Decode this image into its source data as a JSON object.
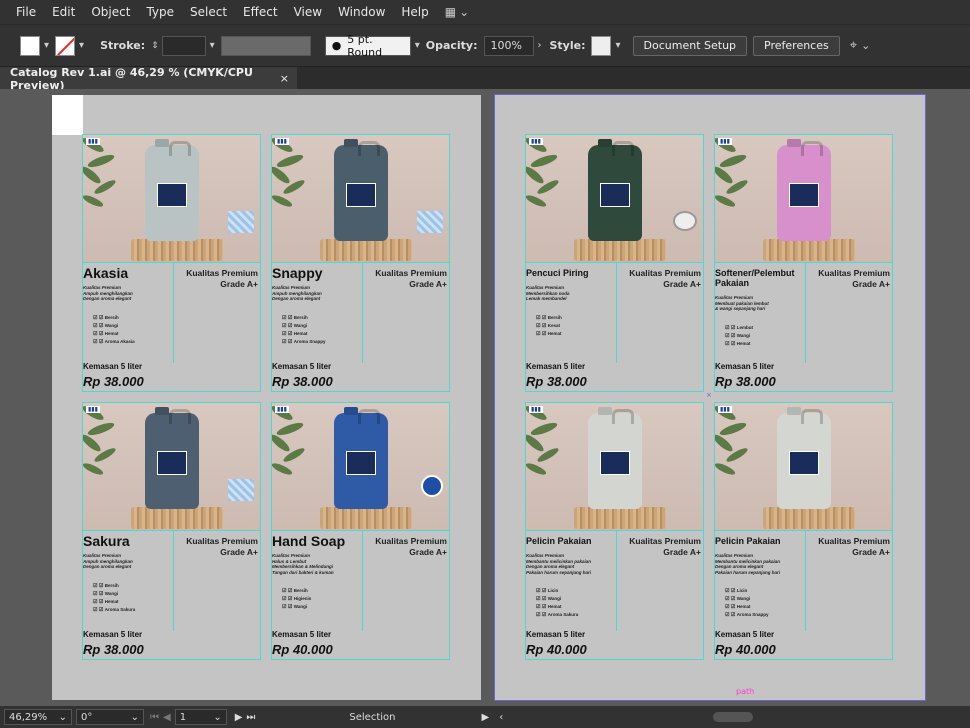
{
  "menu": [
    "File",
    "Edit",
    "Object",
    "Type",
    "Select",
    "Effect",
    "View",
    "Window",
    "Help"
  ],
  "control": {
    "stroke_label": "Stroke:",
    "brush": "5 pt. Round",
    "opacity_label": "Opacity:",
    "opacity": "100%",
    "style_label": "Style:",
    "doc_setup": "Document Setup",
    "preferences": "Preferences"
  },
  "tab": {
    "title": "Catalog Rev 1.ai @ 46,29 % (CMYK/CPU Preview)",
    "close": "×"
  },
  "products": [
    {
      "name": "Akasia",
      "quality": [
        "Kualitas Premium",
        "Grade A+"
      ],
      "desc": [
        "Kualitas Premium",
        "Ampuh menghilangkan",
        "Dengan aroma elegant"
      ],
      "features": [
        "Bersih",
        "Wangi",
        "Hemat",
        "Aroma Akasia"
      ],
      "pack": "Kemasan 5 liter",
      "price": "Rp 38.000",
      "jug": "#b9c3c4",
      "extra": "pattern"
    },
    {
      "name": "Snappy",
      "quality": [
        "Kualitas Premium",
        "Grade A+"
      ],
      "desc": [
        "Kualitas Premium",
        "Ampuh menghilangkan",
        "Dengan aroma elegant"
      ],
      "features": [
        "Bersih",
        "Wangi",
        "Hemat",
        "Aroma Snappy"
      ],
      "pack": "Kemasan 5 liter",
      "price": "Rp 38.000",
      "jug": "#4b5e6c",
      "extra": "pattern"
    },
    {
      "name": "Pencuci Piring",
      "quality": [
        "Kualitas Premium",
        "Grade A+"
      ],
      "desc": [
        "Kualitas Premium",
        "Membersihkan noda",
        "Lemak membandel"
      ],
      "features": [
        "Bersih",
        "Kesat",
        "Hemat"
      ],
      "pack": "Kemasan 5 liter",
      "price": "Rp 38.000",
      "jug": "#2f4a3c",
      "extra": "plate"
    },
    {
      "name": "Softener/Pelembut Pakaian",
      "quality": [
        "Kualitas Premium",
        "Grade A+"
      ],
      "desc": [
        "Kualitas Premium",
        "Membuat pakaian lembut",
        "& wangi sepanjang hari"
      ],
      "features": [
        "Lembut",
        "Wangi",
        "Hemat"
      ],
      "pack": "Kemasan 5 liter",
      "price": "Rp 38.000",
      "jug": "#d790cc",
      "extra": ""
    },
    {
      "name": "Sakura",
      "quality": [
        "Kualitas Premium",
        "Grade A+"
      ],
      "desc": [
        "Kualitas Premium",
        "Ampuh menghilangkan",
        "Dengan aroma elegant"
      ],
      "features": [
        "Bersih",
        "Wangi",
        "Hemat",
        "Aroma Sakura"
      ],
      "pack": "Kemasan 5 liter",
      "price": "Rp 38.000",
      "jug": "#4d5f70",
      "extra": "pattern"
    },
    {
      "name": "Hand Soap",
      "quality": [
        "Kualitas Premium",
        "Grade A+"
      ],
      "desc": [
        "Kualitas Premium",
        "Halus & Lembut",
        "Membersihkan & Melindungi",
        "Tangan dari bakteri & kuman"
      ],
      "features": [
        "Bersih",
        "Higienis",
        "Wangi"
      ],
      "pack": "Kemasan 5 liter",
      "price": "Rp 40.000",
      "jug": "#2e5aa6",
      "extra": "soap"
    },
    {
      "name": "Pelicin Pakaian",
      "quality": [
        "Kualitas Premium",
        "Grade A+"
      ],
      "desc": [
        "Kualitas Premium",
        "Membantu melicinkan pakaian",
        "Dengan aroma elegant",
        "Pakaian harum sepanjang hari"
      ],
      "features": [
        "Licin",
        "Wangi",
        "Hemat",
        "Aroma Sakura"
      ],
      "pack": "Kemasan 5 liter",
      "price": "Rp 40.000",
      "jug": "#d2d5d0",
      "extra": ""
    },
    {
      "name": "Pelicin Pakaian",
      "quality": [
        "Kualitas Premium",
        "Grade A+"
      ],
      "desc": [
        "Kualitas Premium",
        "Membantu melicinkan pakaian",
        "Dengan aroma elegant",
        "Pakaian harum sepanjang hari"
      ],
      "features": [
        "Licin",
        "Wangi",
        "Hemat",
        "Aroma Snappy"
      ],
      "pack": "Kemasan 5 liter",
      "price": "Rp 40.000",
      "jug": "#d4d6d2",
      "extra": ""
    }
  ],
  "path_label": "path",
  "status": {
    "zoom": "46,29%",
    "rotate": "0°",
    "artboard": "1",
    "tool": "Selection"
  },
  "colors": {
    "selection_outline": "#4fd8d0",
    "artboard_outline": "#6c64d9"
  }
}
